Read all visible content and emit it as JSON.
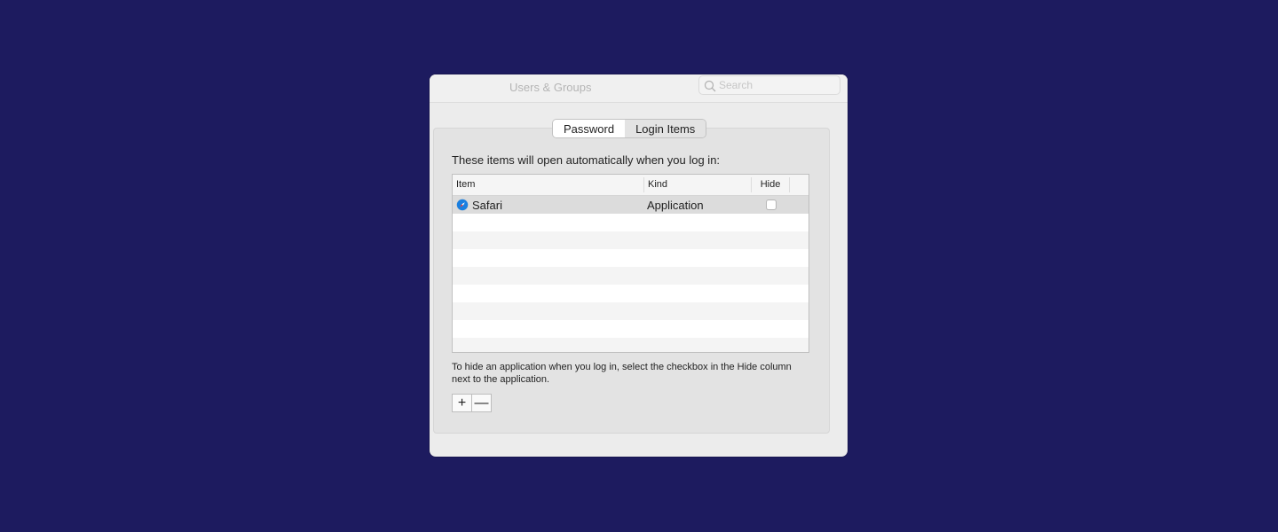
{
  "window": {
    "title": "Users & Groups",
    "search": {
      "placeholder": "Search",
      "value": ""
    }
  },
  "tabs": [
    {
      "label": "Password",
      "active": true
    },
    {
      "label": "Login Items",
      "active": false
    }
  ],
  "login_items": {
    "intro": "These items will open automatically when you log in:",
    "columns": {
      "item": "Item",
      "kind": "Kind",
      "hide": "Hide"
    },
    "rows": [
      {
        "icon": "safari-icon",
        "item": "Safari",
        "kind": "Application",
        "hide": false,
        "selected": true
      }
    ],
    "help_text": "To hide an application when you log in, select the checkbox in the Hide column next to the application.",
    "add_label": "+",
    "remove_label": "—"
  },
  "colors": {
    "background": "#1d1b5f",
    "window": "#ececec",
    "panel": "#e3e3e3",
    "safari_accent": "#1a7fe0"
  }
}
